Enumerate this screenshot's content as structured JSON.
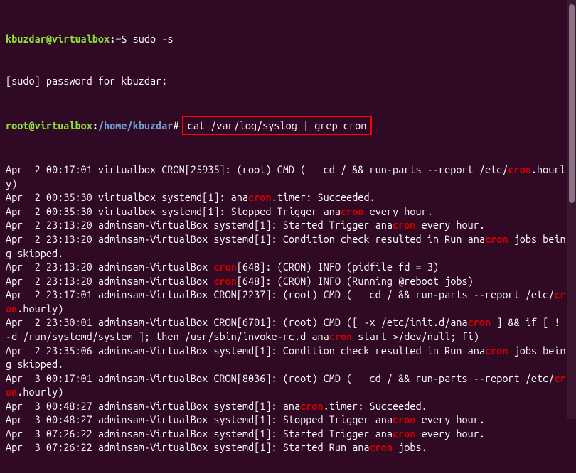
{
  "prompt1": {
    "user": "kbuzdar",
    "at": "@",
    "host": "virtualbox",
    "path": "~",
    "symbol": "$",
    "command": " sudo -s"
  },
  "sudoline": "[sudo] password for kbuzdar:",
  "prompt2": {
    "user": "root",
    "at": "@",
    "host": "virtualbox",
    "path": "/home/kbuzdar",
    "symbol": "#",
    "command": "cat /var/log/syslog | grep cron"
  },
  "log": [
    {
      "pre": "Apr  2 00:17:01 virtualbox CRON[25935]: (root) CMD (   cd / && run-parts --report /etc/",
      "m": "cron",
      "post": ".hourly)"
    },
    {
      "pre": "Apr  2 00:35:30 virtualbox systemd[1]: ana",
      "m": "cron",
      "post": ".timer: Succeeded."
    },
    {
      "pre": "Apr  2 00:35:30 virtualbox systemd[1]: Stopped Trigger ana",
      "m": "cron",
      "post": " every hour."
    },
    {
      "pre": "Apr  2 23:13:20 adminsam-VirtualBox systemd[1]: Started Trigger ana",
      "m": "cron",
      "post": " every hour."
    },
    {
      "pre": "Apr  2 23:13:20 adminsam-VirtualBox systemd[1]: Condition check resulted in Run ana",
      "m": "cron",
      "post": " jobs being skipped."
    },
    {
      "pre": "Apr  2 23:13:20 adminsam-VirtualBox ",
      "m": "cron",
      "post": "[648]: (CRON) INFO (pidfile fd = 3)"
    },
    {
      "pre": "Apr  2 23:13:20 adminsam-VirtualBox ",
      "m": "cron",
      "post": "[648]: (CRON) INFO (Running @reboot jobs)"
    },
    {
      "pre": "Apr  2 23:17:01 adminsam-VirtualBox CRON[2237]: (root) CMD (   cd / && run-parts --report /etc/",
      "m": "cron",
      "post": ".hourly)"
    },
    {
      "parts": [
        {
          "t": "Apr  2 23:30:01 adminsam-VirtualBox CRON[6701]: (root) CMD ([ -x /etc/init.d/ana"
        },
        {
          "t": "cron",
          "hl": true
        },
        {
          "t": " ] && if [ ! -d /run/systemd/system ]; then /usr/sbin/invoke-rc.d ana"
        },
        {
          "t": "cron",
          "hl": true
        },
        {
          "t": " start >/dev/null; fi)"
        }
      ]
    },
    {
      "pre": "Apr  2 23:35:06 adminsam-VirtualBox systemd[1]: Condition check resulted in Run ana",
      "m": "cron",
      "post": " jobs being skipped."
    },
    {
      "pre": "Apr  3 00:17:01 adminsam-VirtualBox CRON[8036]: (root) CMD (   cd / && run-parts --report /etc/",
      "m": "cron",
      "post": ".hourly)"
    },
    {
      "pre": "Apr  3 00:48:27 adminsam-VirtualBox systemd[1]: ana",
      "m": "cron",
      "post": ".timer: Succeeded."
    },
    {
      "pre": "Apr  3 00:48:27 adminsam-VirtualBox systemd[1]: Stopped Trigger ana",
      "m": "cron",
      "post": " every hour."
    },
    {
      "pre": "Apr  3 07:26:22 adminsam-VirtualBox systemd[1]: Started Trigger ana",
      "m": "cron",
      "post": " every hour."
    },
    {
      "pre": "Apr  3 07:26:22 adminsam-VirtualBox systemd[1]: Started Run ana",
      "m": "cron",
      "post": " jobs."
    }
  ]
}
